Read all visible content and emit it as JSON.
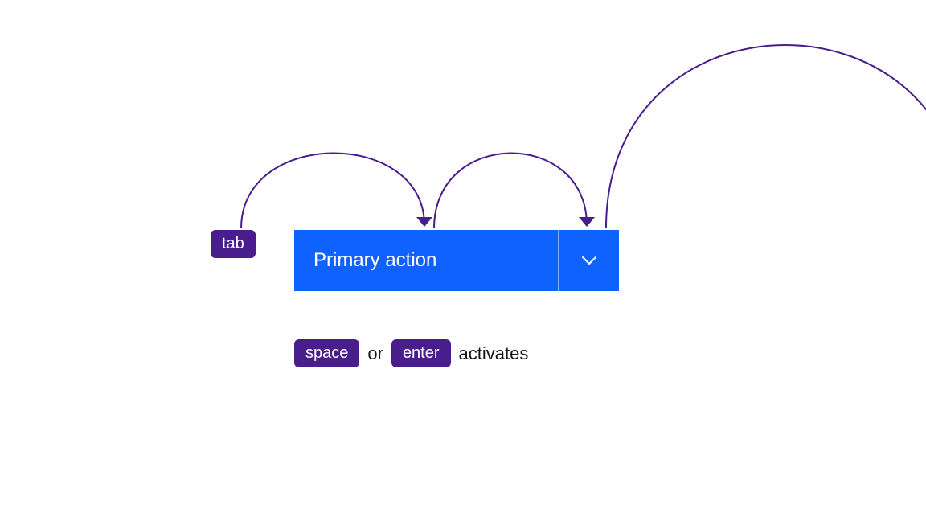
{
  "keys": {
    "tab": "tab",
    "space": "space",
    "enter": "enter"
  },
  "button": {
    "primary_label": "Primary action"
  },
  "icons": {
    "chevron": "chevron-down"
  },
  "connectors": {
    "or": "or",
    "activates": "activates"
  },
  "colors": {
    "key_bg": "#491d8b",
    "button_bg": "#0f62fe",
    "arrow": "#491d8b"
  }
}
